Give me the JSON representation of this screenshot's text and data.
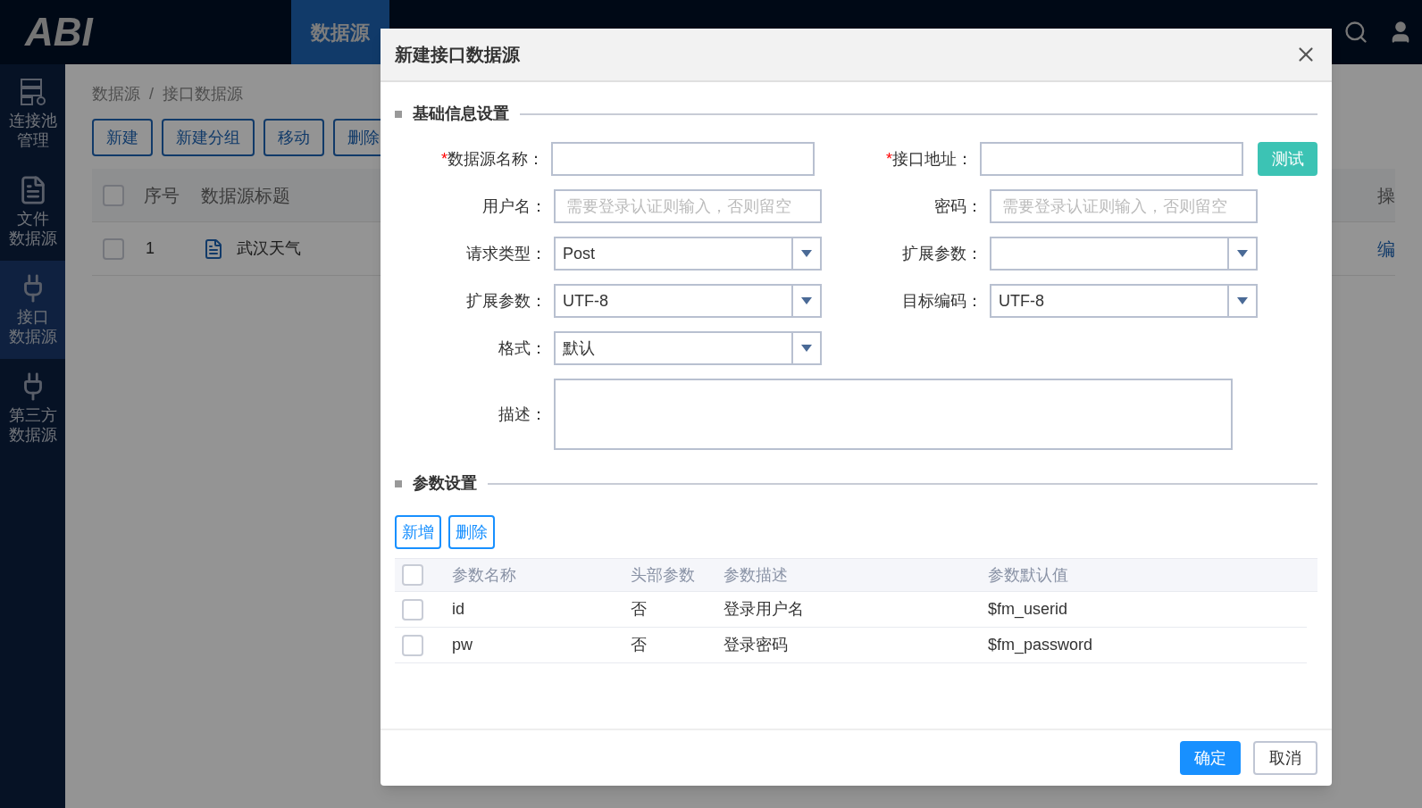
{
  "header": {
    "logo": "ABI",
    "nav": [
      {
        "label": "数据源",
        "selected": true
      }
    ]
  },
  "sidebar": {
    "items": [
      {
        "kind": "server",
        "lines": [
          "连接池",
          "管理"
        ],
        "selected": false
      },
      {
        "kind": "file",
        "lines": [
          "文件",
          "数据源"
        ],
        "selected": false
      },
      {
        "kind": "plug",
        "lines": [
          "接口",
          "数据源"
        ],
        "selected": true
      },
      {
        "kind": "plug",
        "lines": [
          "第三方",
          "数据源"
        ],
        "selected": false
      }
    ]
  },
  "page": {
    "breadcrumb": [
      "数据源",
      "/",
      "接口数据源"
    ],
    "toolbar": [
      "新建",
      "新建分组",
      "移动",
      "删除"
    ],
    "table": {
      "all_checked": false,
      "columns": [
        "序号",
        "数据源标题"
      ],
      "actions_column": "操",
      "rows": [
        {
          "index": "1",
          "title": "武汉天气",
          "action": "编",
          "checked": false
        }
      ]
    }
  },
  "dialog": {
    "title": "新建接口数据源",
    "sections": [
      {
        "title": "基础信息设置"
      },
      {
        "title": "参数设置"
      }
    ],
    "fields": [
      {
        "kind": "input",
        "required_mark": "*",
        "label": "数据源名称："
      },
      {
        "kind": "input",
        "required_mark": "*",
        "label": "接口地址：",
        "button": "测试"
      },
      {
        "kind": "input",
        "label": "用户名：",
        "placeholder": "需要登录认证则输入，否则留空"
      },
      {
        "kind": "input",
        "label": "密码：",
        "placeholder": "需要登录认证则输入，否则留空"
      },
      {
        "kind": "select",
        "label": "请求类型：",
        "value": "Post"
      },
      {
        "kind": "select",
        "label": "扩展参数："
      },
      {
        "kind": "select",
        "label": "扩展参数：",
        "value": "UTF-8"
      },
      {
        "kind": "select",
        "label": "目标编码：",
        "value": "UTF-8"
      },
      {
        "kind": "select",
        "label": "格式：",
        "value": "默认"
      },
      {
        "kind": "textarea",
        "label": "描述："
      }
    ],
    "param_buttons": [
      "新增",
      "删除"
    ],
    "params": {
      "columns": [
        "参数名称",
        "头部参数",
        "参数描述",
        "参数默认值"
      ],
      "all_checked": false,
      "rows": [
        {
          "name": "id",
          "header": "否",
          "description": "登录用户名",
          "default": "$fm_userid",
          "checked": false
        },
        {
          "name": "pw",
          "header": "否",
          "description": "登录密码",
          "default": "$fm_password",
          "checked": false
        }
      ]
    },
    "footer": [
      {
        "label": "确定",
        "kind": "primary"
      },
      {
        "label": "取消",
        "kind": "default"
      }
    ]
  }
}
